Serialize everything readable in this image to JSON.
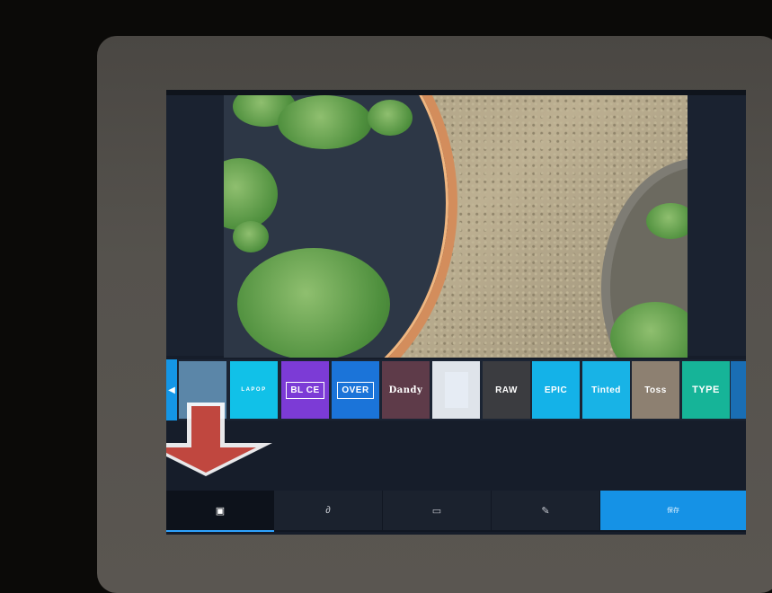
{
  "effects": {
    "tiles": [
      {
        "label": "",
        "color": "#5b86a8"
      },
      {
        "label": "LAPOP",
        "color": "#11c1e8"
      },
      {
        "label": "BL CE",
        "color": "#7c3bd6"
      },
      {
        "label": "OVER",
        "color": "#1b74d9"
      },
      {
        "label": "Dandy",
        "color": "#5e3b49"
      },
      {
        "label": "",
        "color": "#dfe4ea"
      },
      {
        "label": "RAW",
        "color": "#3b3c40"
      },
      {
        "label": "EPIC",
        "color": "#14b2e8"
      },
      {
        "label": "Tinted",
        "color": "#18b3e6"
      },
      {
        "label": "Toss",
        "color": "#8d8071"
      },
      {
        "label": "TYPE",
        "color": "#16b498"
      }
    ]
  },
  "toolbar": {
    "tabs": [
      {
        "icon": "crop-icon",
        "active": true
      },
      {
        "icon": "link-icon",
        "active": false
      },
      {
        "icon": "frame-icon",
        "active": false
      },
      {
        "icon": "pen-icon",
        "active": false
      }
    ],
    "save_label": "保存"
  },
  "colors": {
    "accent": "#1592e6",
    "arrow": "#c0473f"
  }
}
